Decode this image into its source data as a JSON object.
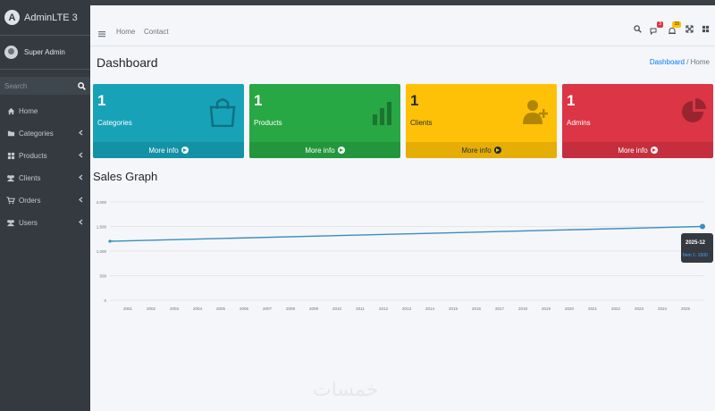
{
  "sidebar": {
    "brand": "AdminLTE 3",
    "brand_logo_letter": "A",
    "user_name": "Super Admin",
    "search_placeholder": "Search",
    "items": [
      {
        "label": "Home",
        "icon": "home-icon",
        "has_arrow": false
      },
      {
        "label": "Categories",
        "icon": "folder-icon",
        "has_arrow": true
      },
      {
        "label": "Products",
        "icon": "grid-icon",
        "has_arrow": true
      },
      {
        "label": "Clients",
        "icon": "users-icon",
        "has_arrow": true
      },
      {
        "label": "Orders",
        "icon": "cart-icon",
        "has_arrow": true
      },
      {
        "label": "Users",
        "icon": "users-icon",
        "has_arrow": true
      }
    ]
  },
  "topbar": {
    "links": [
      "Home",
      "Contact"
    ],
    "messages_badge": "3",
    "notifications_badge": "15"
  },
  "page": {
    "title": "Dashboard",
    "breadcrumb": [
      "Dashboard",
      "Home"
    ]
  },
  "stat_boxes": [
    {
      "value": "1",
      "label": "Categories",
      "footer": "More info",
      "color": "#17a2b8",
      "icon": "shopping-bag-icon"
    },
    {
      "value": "1",
      "label": "Products",
      "footer": "More info",
      "color": "#28a745",
      "icon": "bar-chart-icon"
    },
    {
      "value": "1",
      "label": "Clients",
      "footer": "More info",
      "color": "#ffc107",
      "icon": "user-plus-icon"
    },
    {
      "value": "1",
      "label": "Admins",
      "footer": "More info",
      "color": "#dc3545",
      "icon": "pie-chart-icon"
    }
  ],
  "graph": {
    "title": "Sales Graph"
  },
  "chart_data": {
    "type": "line",
    "categories": [
      "2001",
      "2002",
      "2003",
      "2004",
      "2005",
      "2006",
      "2007",
      "2008",
      "2009",
      "2010",
      "2011",
      "2012",
      "2013",
      "2014",
      "2015",
      "2016",
      "2017",
      "2018",
      "2019",
      "2020",
      "2021",
      "2022",
      "2023",
      "2024",
      "2025"
    ],
    "y_ticks": [
      "0",
      "500",
      "1,000",
      "1,500",
      "2,000"
    ],
    "ylim": [
      0,
      2000
    ],
    "series": [
      {
        "start_value": 1200,
        "end_value": 1500,
        "color": "#3c8dbc"
      }
    ],
    "tooltip": {
      "title": "2025-12",
      "value": "Item 1: 1500"
    },
    "grid": true
  },
  "watermark": "خمسات"
}
